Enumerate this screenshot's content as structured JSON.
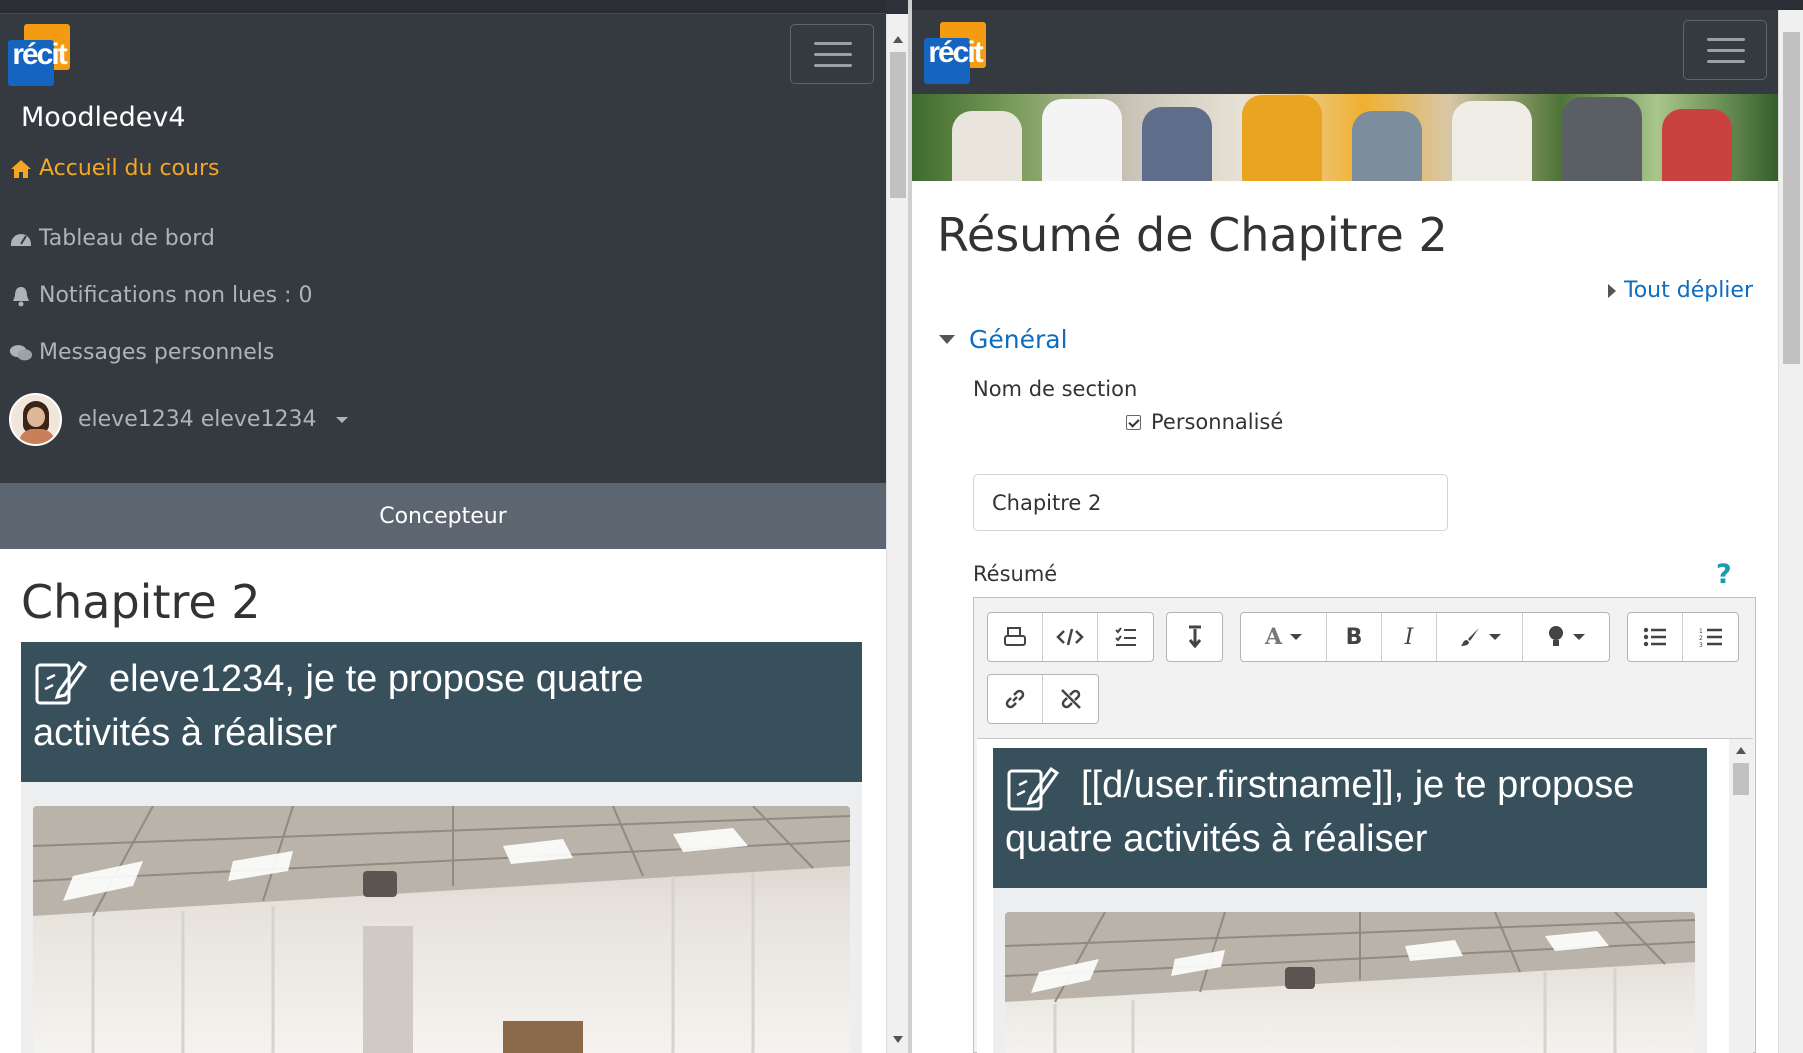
{
  "left": {
    "logo_text": "récit",
    "site_name": "Moodledev4",
    "nav": [
      {
        "label": "Accueil du cours",
        "icon": "home-icon"
      },
      {
        "label": "Tableau de bord",
        "icon": "dashboard-icon"
      },
      {
        "label": "Notifications non lues : 0",
        "icon": "bell-icon"
      },
      {
        "label": "Messages personnels",
        "icon": "messages-icon"
      }
    ],
    "user_name": "eleve1234 eleve1234",
    "mode_label": "Concepteur",
    "page_title": "Chapitre 2",
    "banner_text_line1": "eleve1234, je te propose quatre",
    "banner_text_line2": "activités à réaliser"
  },
  "right": {
    "logo_text": "récit",
    "form_title": "Résumé de Chapitre 2",
    "expand_all": "Tout déplier",
    "section_title": "Général",
    "section_name_label": "Nom de section",
    "custom_checkbox_label": "Personnalisé",
    "section_name_value": "Chapitre 2",
    "summary_label": "Résumé",
    "help_glyph": "?",
    "editor_banner_line1": "[[d/user.firstname]], je te propose",
    "editor_banner_line2": "quatre activités à réaliser",
    "toolbar": {
      "bold": "B",
      "italic": "I",
      "font_color": "A"
    }
  },
  "colors": {
    "nav_bg": "#343a40",
    "active_nav": "#f5a623",
    "link_blue": "#0f6cbf",
    "banner_bg": "#37505c",
    "concepteur_bg": "#5b6670"
  }
}
